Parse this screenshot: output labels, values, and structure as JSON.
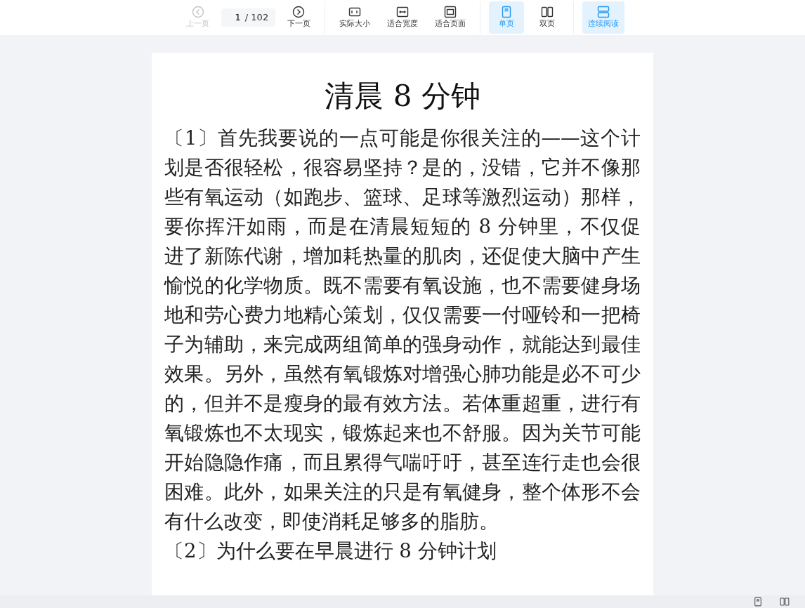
{
  "toolbar": {
    "groups": [
      {
        "items": [
          {
            "label": "上一页",
            "disabled": true,
            "selected": false
          },
          {
            "kind": "pager",
            "value": "1",
            "total": "/ 102"
          },
          {
            "label": "下一页",
            "disabled": false,
            "selected": false
          }
        ]
      },
      {
        "items": [
          {
            "label": "实际大小",
            "disabled": false,
            "selected": false
          },
          {
            "label": "适合宽度",
            "disabled": false,
            "selected": false
          },
          {
            "label": "适合页面",
            "disabled": false,
            "selected": false
          }
        ]
      },
      {
        "items": [
          {
            "label": "单页",
            "disabled": false,
            "selected": true
          },
          {
            "label": "双页",
            "disabled": false,
            "selected": false
          }
        ]
      },
      {
        "items": [
          {
            "label": "连续阅读",
            "disabled": false,
            "selected": true
          }
        ]
      }
    ]
  },
  "document": {
    "title": "清晨 8 分钟",
    "paragraphs": [
      "〔1〕首先我要说的一点可能是你很关注的——这个计划是否很轻松，很容易坚持？是的，没错，它并不像那些有氧运动（如跑步、篮球、足球等激烈运动）那样，要你挥汗如雨，而是在清晨短短的 8 分钟里，不仅促进了新陈代谢，增加耗热量的肌肉，还促使大脑中产生愉悦的化学物质。既不需要有氧设施，也不需要健身场地和劳心费力地精心策划，仅仅需要一付哑铃和一把椅子为辅助，来完成两组简单的强身动作，就能达到最佳效果。另外，虽然有氧锻炼对增强心肺功能是必不可少的，但并不是瘦身的最有效方法。若体重超重，进行有氧锻炼也不太现实，锻炼起来也不舒服。因为关节可能开始隐隐作痛，而且累得气喘吁吁，甚至连行走也会很困难。此外，如果关注的只是有氧健身，整个体形不会有什么改变，即使消耗足够多的脂肪。",
      "〔2〕为什么要在早晨进行 8 分钟计划"
    ]
  }
}
